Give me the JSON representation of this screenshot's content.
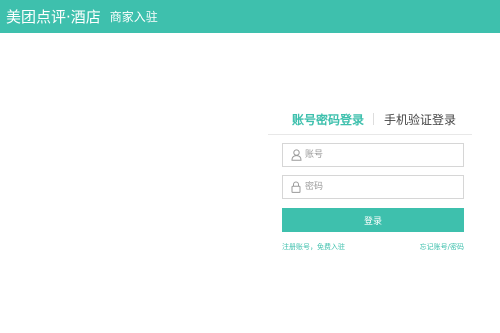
{
  "header": {
    "brand": "美团点评·酒店",
    "subtitle": "商家入驻",
    "color": "#3ec0ad"
  },
  "login": {
    "tabs": [
      {
        "label": "账号密码登录",
        "active": true
      },
      {
        "label": "手机验证登录",
        "active": false
      }
    ],
    "username_placeholder": "账号",
    "username_icon": "user-icon",
    "password_placeholder": "密码",
    "password_icon": "lock-icon",
    "submit_label": "登录",
    "register_link": "注册账号，免费入驻",
    "forgot_link": "忘记账号/密码"
  }
}
